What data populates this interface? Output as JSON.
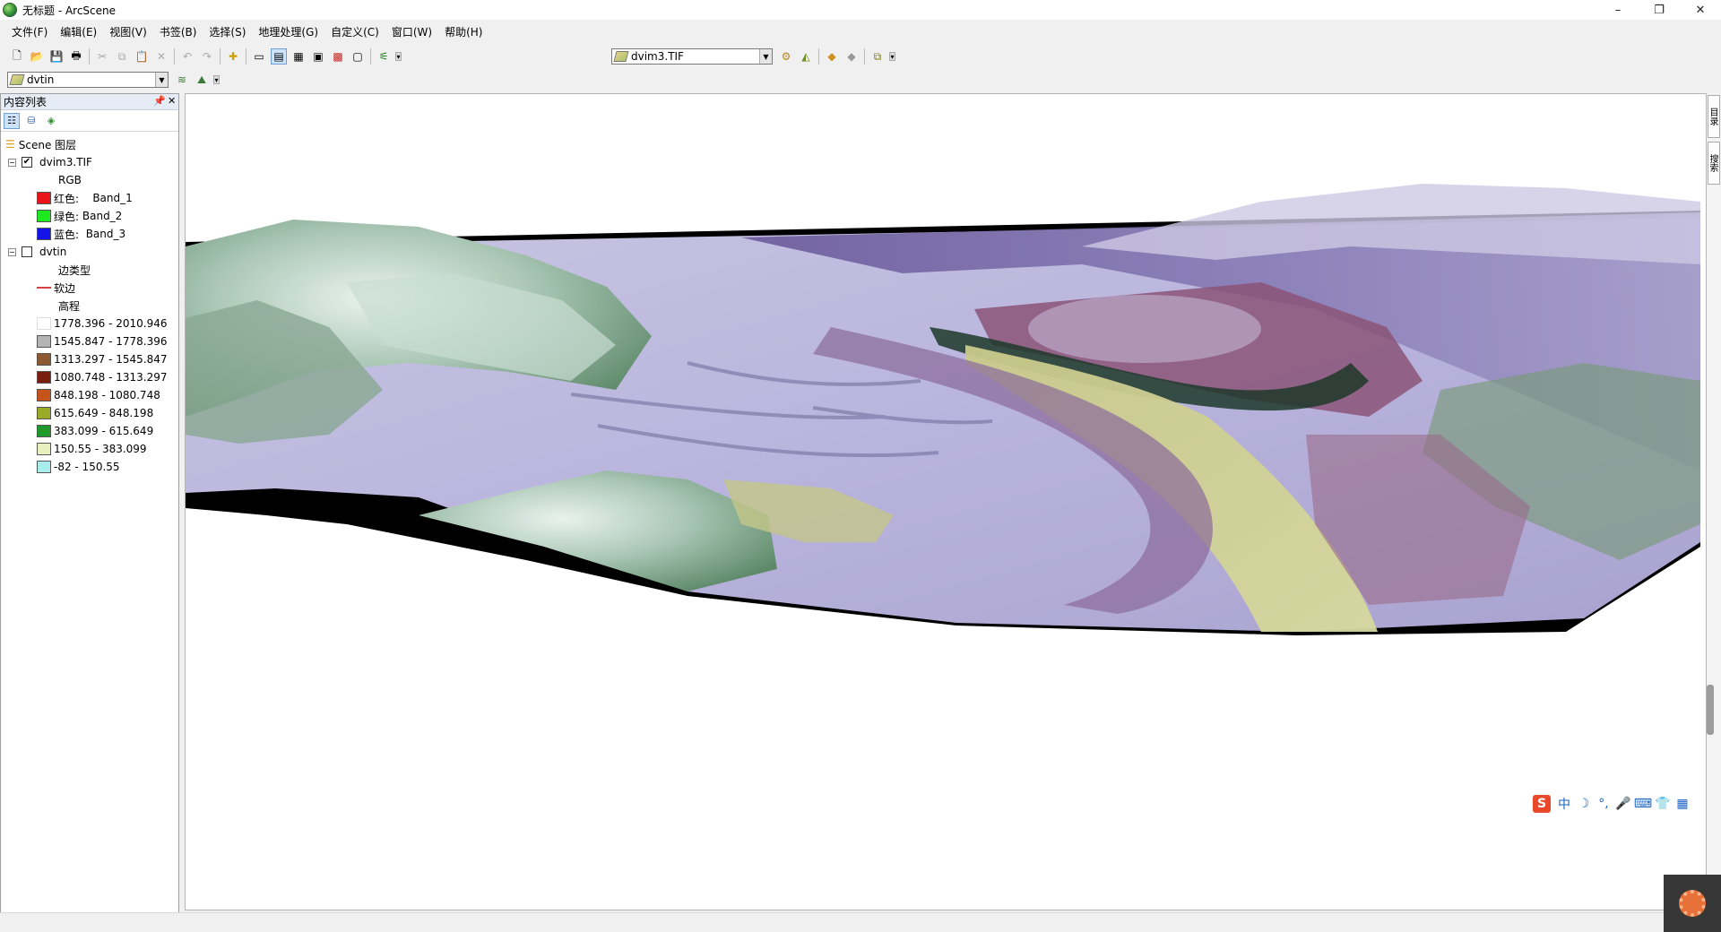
{
  "window": {
    "title": "无标题 - ArcScene",
    "buttons": [
      "–",
      "❐",
      "✕"
    ]
  },
  "menubar": {
    "items": [
      "文件(F)",
      "编辑(E)",
      "视图(V)",
      "书签(B)",
      "选择(S)",
      "地理处理(G)",
      "自定义(C)",
      "窗口(W)",
      "帮助(H)"
    ]
  },
  "toolbar": {
    "layer_select": "dvim3.TIF",
    "layer_select2": "dvtin"
  },
  "toc": {
    "title": "内容列表",
    "scene_label": "Scene 图层",
    "layers": [
      {
        "name": "dvim3.TIF",
        "checked": true,
        "renderer": "RGB",
        "bands": [
          {
            "label": "红色:",
            "value": "Band_1",
            "color": "#e8141a"
          },
          {
            "label": "绿色:",
            "value": "Band_2",
            "color": "#1ee81e"
          },
          {
            "label": "蓝色:",
            "value": "Band_3",
            "color": "#1414e8"
          }
        ]
      },
      {
        "name": "dvtin",
        "checked": false,
        "edge_type_label": "边类型",
        "edge_label": "软边",
        "elevation_label": "高程",
        "classes": [
          {
            "range": "1778.396 - 2010.946",
            "color": "#ffffff"
          },
          {
            "range": "1545.847 - 1778.396",
            "color": "#b5b5b5"
          },
          {
            "range": "1313.297 - 1545.847",
            "color": "#8b5a32"
          },
          {
            "range": "1080.748 - 1313.297",
            "color": "#7a1e10"
          },
          {
            "range": "848.198 - 1080.748",
            "color": "#c5541a"
          },
          {
            "range": "615.649 - 848.198",
            "color": "#9aab2a"
          },
          {
            "range": "383.099 - 615.649",
            "color": "#1f9a2a"
          },
          {
            "range": "150.55 - 383.099",
            "color": "#e8f0c0"
          },
          {
            "range": "-82 - 150.55",
            "color": "#a8ecec"
          }
        ]
      }
    ]
  },
  "side_rail": {
    "tab1": "目录",
    "tab2": "搜索"
  },
  "ime": {
    "logo": "S",
    "icons": [
      "中",
      "☽",
      "°,",
      "🎤",
      "⌨",
      "👕",
      "▦"
    ]
  }
}
